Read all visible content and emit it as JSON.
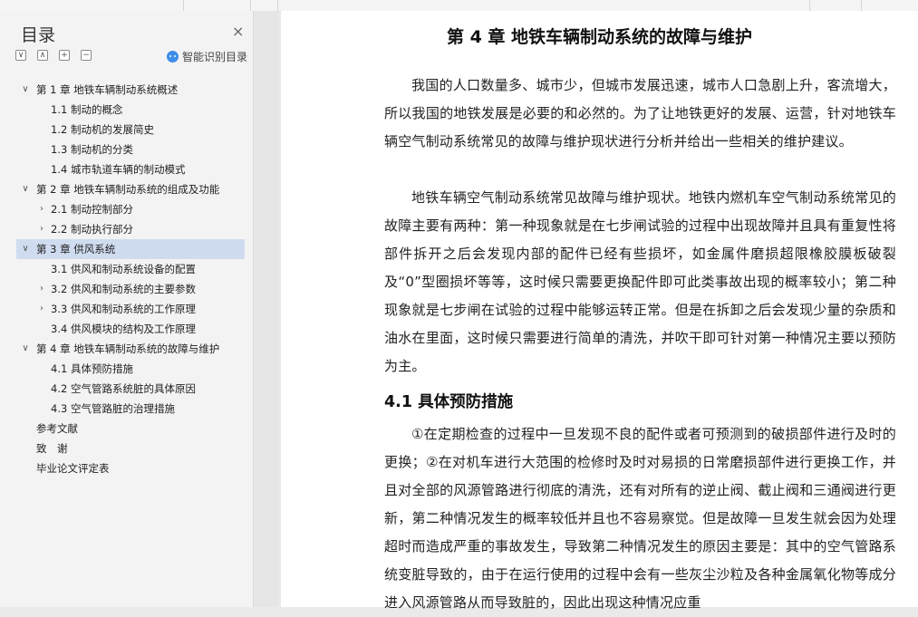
{
  "outline": {
    "title": "目录",
    "close_glyph": "×",
    "tools": [
      "∨",
      "∧",
      "+",
      "−"
    ],
    "smart_label": "智能识别目录",
    "items": [
      {
        "label": "第 1 章  地铁车辆制动系统概述",
        "level": 0,
        "chev": "∨"
      },
      {
        "label": "1.1 制动的概念",
        "level": 1,
        "chev": ""
      },
      {
        "label": "1.2 制动机的发展简史",
        "level": 1,
        "chev": ""
      },
      {
        "label": "1.3 制动机的分类",
        "level": 1,
        "chev": ""
      },
      {
        "label": "1.4 城市轨道车辆的制动模式",
        "level": 1,
        "chev": ""
      },
      {
        "label": "第 2 章  地铁车辆制动系统的组成及功能",
        "level": 0,
        "chev": "∨"
      },
      {
        "label": "2.1 制动控制部分",
        "level": 1,
        "chev": "›"
      },
      {
        "label": "2.2 制动执行部分",
        "level": 1,
        "chev": "›"
      },
      {
        "label": "第 3 章  供风系统",
        "level": 0,
        "chev": "∨",
        "selected": true
      },
      {
        "label": "3.1 供风和制动系统设备的配置",
        "level": 1,
        "chev": ""
      },
      {
        "label": "3.2 供风和制动系统的主要参数",
        "level": 1,
        "chev": "›"
      },
      {
        "label": "3.3 供风和制动系统的工作原理",
        "level": 1,
        "chev": "›"
      },
      {
        "label": "3.4 供风模块的结构及工作原理",
        "level": 1,
        "chev": ""
      },
      {
        "label": "第 4 章  地铁车辆制动系统的故障与维护",
        "level": 0,
        "chev": "∨"
      },
      {
        "label": "4.1 具体预防措施",
        "level": 1,
        "chev": ""
      },
      {
        "label": "4.2 空气管路系统脏的具体原因",
        "level": 1,
        "chev": ""
      },
      {
        "label": "4.3 空气管路脏的治理措施",
        "level": 1,
        "chev": ""
      },
      {
        "label": "参考文献",
        "level": 0,
        "chev": ""
      },
      {
        "label": "致　谢",
        "level": 0,
        "chev": ""
      },
      {
        "label": "毕业论文评定表",
        "level": 0,
        "chev": ""
      }
    ]
  },
  "document": {
    "chapter_title": "第 4 章  地铁车辆制动系统的故障与维护",
    "para1": "我国的人口数量多、城市少，但城市发展迅速，城市人口急剧上升，客流增大，所以我国的地铁发展是必要的和必然的。为了让地铁更好的发展、运营，针对地铁车辆空气制动系统常见的故障与维护现状进行分析并给出一些相关的维护建议。",
    "para2": "地铁车辆空气制动系统常见故障与维护现状。地铁内燃机车空气制动系统常见的故障主要有两种：第一种现象就是在七步闸试验的过程中出现故障并且具有重复性将部件拆开之后会发现内部的配件已经有些损坏，如金属件磨损超限橡胶膜板破裂及“0”型圈损坏等等，这时候只需要更换配件即可此类事故出现的概率较小；第二种现象就是七步闸在试验的过程中能够运转正常。但是在拆卸之后会发现少量的杂质和油水在里面，这时候只需要进行简单的清洗，并吹干即可针对第一种情况主要以预防为主。",
    "section_title": "4.1 具体预防措施",
    "para3": "①在定期检查的过程中一旦发现不良的配件或者可预测到的破损部件进行及时的更换；②在对机车进行大范围的检修时及时对易损的日常磨损部件进行更换工作，并且对全部的风源管路进行彻底的清洗，还有对所有的逆止阀、截止阀和三通阀进行更新，第二种情况发生的概率较低并且也不容易察觉。但是故障一旦发生就会因为处理超时而造成严重的事故发生，导致第二种情况发生的原因主要是：其中的空气管路系统变脏导致的，由于在运行使用的过程中会有一些灰尘沙粒及各种金属氧化物等成分进入风源管路从而导致脏的，因此出现这种情况应重"
  }
}
